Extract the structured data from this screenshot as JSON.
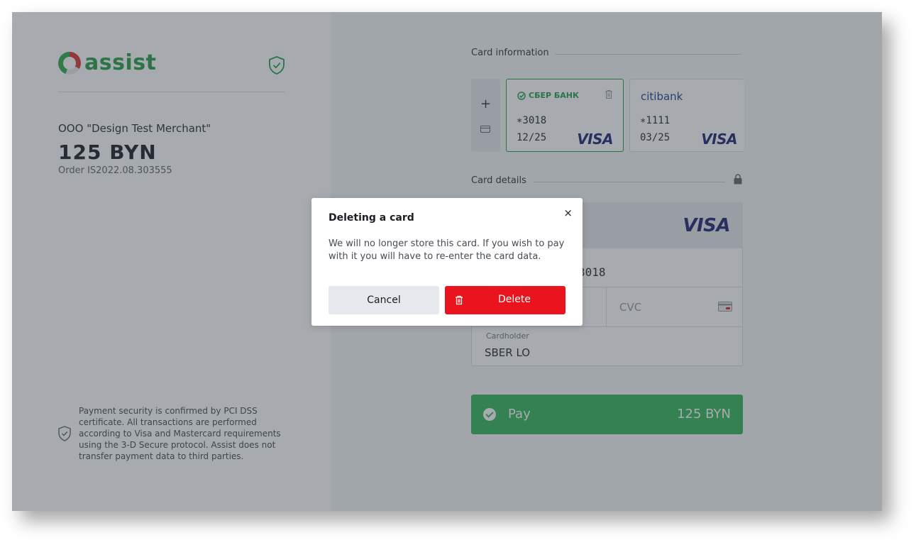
{
  "brand": {
    "name": "assist",
    "color": "#1f9a43"
  },
  "merchant": {
    "name": "OOO \"Design Test Merchant\"",
    "amount": "125 BYN",
    "order": "Order IS2022.08.303555"
  },
  "security_note": "Payment security is confirmed by PCI DSS certificate. All transactions are performed according to Visa and Mastercard requirements using the 3-D Secure protocol. Assist does not transfer payment data to third parties.",
  "sections": {
    "card_information": "Card information",
    "card_details": "Card details"
  },
  "add_card": {
    "plus": "+"
  },
  "saved_cards": [
    {
      "bank": "СБЕР БАНК",
      "number": "∗3018",
      "expiry": "12/25",
      "network": "VISA",
      "selected": true,
      "bank_color": "#1f9a43"
    },
    {
      "bank": "citibank",
      "number": "∗1111",
      "expiry": "03/25",
      "network": "VISA",
      "selected": false,
      "bank_color": "#1a3a8c"
    }
  ],
  "form": {
    "network": "VISA",
    "card_number_visible": "3018",
    "cvc_placeholder": "CVC",
    "cardholder_label": "Cardholder",
    "cardholder_value": "SBER LO"
  },
  "pay_button": {
    "label": "Pay",
    "amount": "125 BYN",
    "color": "#2fb257"
  },
  "modal": {
    "title": "Deleting a card",
    "close": "×",
    "body": "We will no longer store this card. If you wish to pay with it you will have to re-enter the card data.",
    "cancel_label": "Cancel",
    "delete_label": "Delete",
    "delete_color": "#e9141d"
  }
}
